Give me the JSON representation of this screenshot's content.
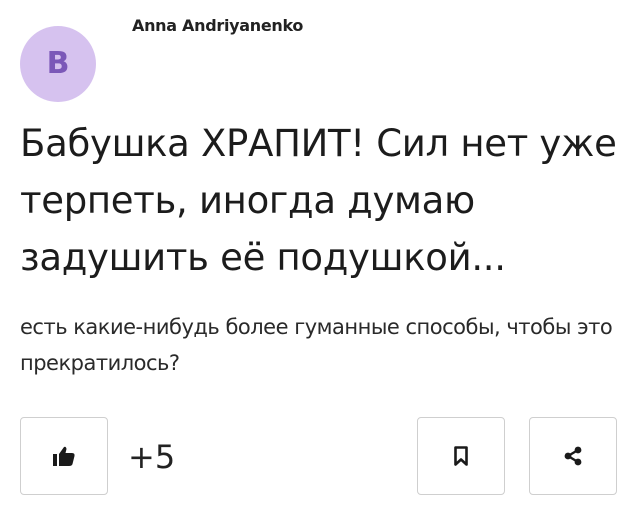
{
  "author": {
    "avatar_letter": "B",
    "name": "Anna Andriyanenko",
    "avatar_color": "#d6c2ef",
    "avatar_text_color": "#7b58b8"
  },
  "post": {
    "title": "Бабушка ХРАПИТ! Сил нет уже терпеть, иногда думаю задушить её подушкой...",
    "body": "есть какие-нибудь более гуманные способы, чтобы это прекратилось?"
  },
  "actions": {
    "like_count": "+5",
    "like_icon": "thumbs-up-icon",
    "bookmark_icon": "bookmark-icon",
    "share_icon": "share-icon"
  }
}
